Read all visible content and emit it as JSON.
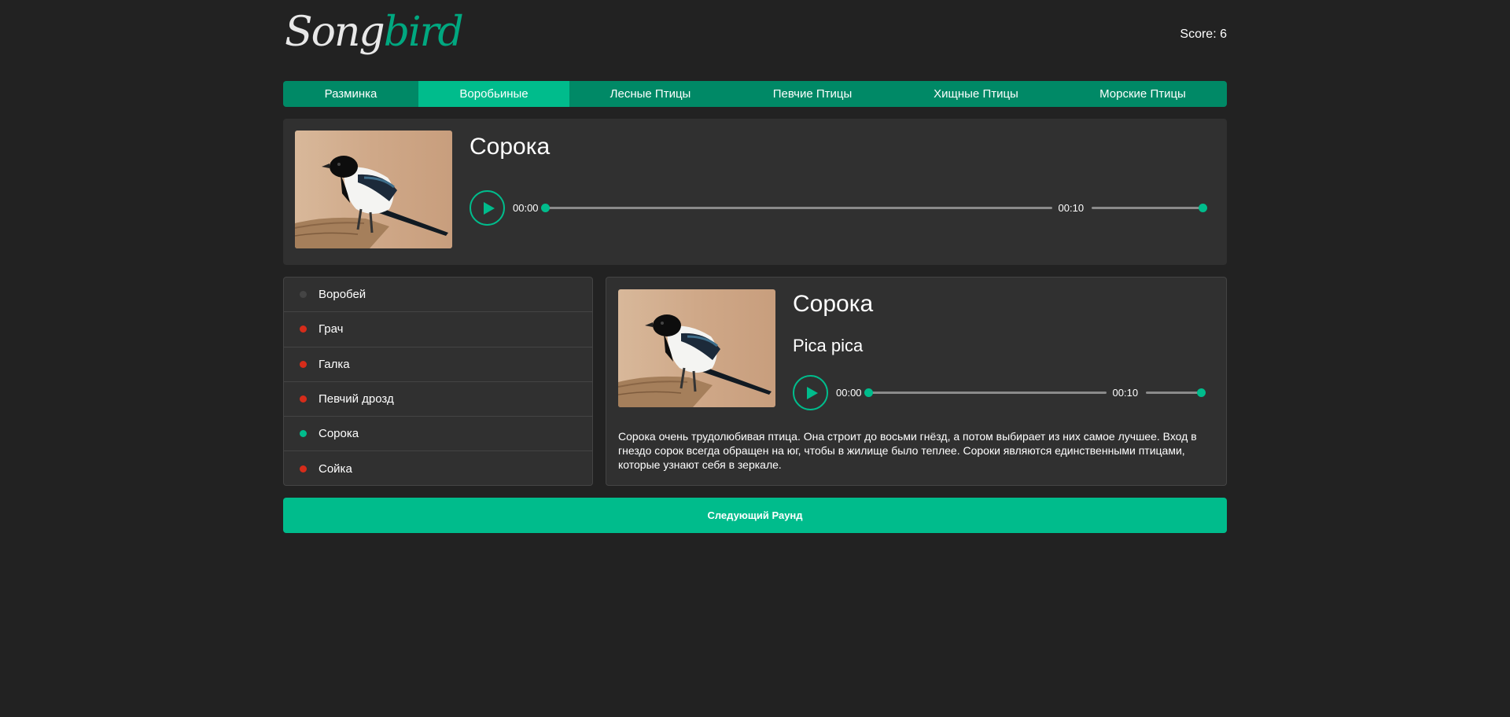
{
  "header": {
    "logo_part1": "Song",
    "logo_part2": "bird",
    "score": "Score: 6"
  },
  "nav": [
    {
      "label": "Разминка",
      "active": false
    },
    {
      "label": "Воробьиные",
      "active": true
    },
    {
      "label": "Лесные Птицы",
      "active": false
    },
    {
      "label": "Певчие Птицы",
      "active": false
    },
    {
      "label": "Хищные Птицы",
      "active": false
    },
    {
      "label": "Морские Птицы",
      "active": false
    }
  ],
  "question": {
    "title": "Сорока",
    "image_icon": "magpie-photo",
    "player": {
      "current": "00:00",
      "duration": "00:10",
      "progress": 0,
      "volume": 1
    }
  },
  "answers": [
    {
      "label": "Воробей",
      "status_color": "#444444"
    },
    {
      "label": "Грач",
      "status_color": "#d62c1a"
    },
    {
      "label": "Галка",
      "status_color": "#d62c1a"
    },
    {
      "label": "Певчий дрозд",
      "status_color": "#d62c1a"
    },
    {
      "label": "Сорока",
      "status_color": "#00bc8c"
    },
    {
      "label": "Сойка",
      "status_color": "#d62c1a"
    }
  ],
  "details": {
    "name": "Сорока",
    "latin": "Pica pica",
    "image_icon": "magpie-photo",
    "player": {
      "current": "00:00",
      "duration": "00:10",
      "progress": 0,
      "volume": 1
    },
    "description": "Сорока очень трудолюбивая птица. Она строит до восьми гнёзд, а потом выбирает из них самое лучшее. Вход в гнездо сорок всегда обращен на юг, чтобы в жилище было теплее. Сороки являются единственными птицами, которые узнают себя в зеркале."
  },
  "next_button": "Следующий Раунд",
  "colors": {
    "accent": "#00bc8c",
    "nav_bg": "#008966",
    "wrong": "#d62c1a",
    "unanswered": "#444444",
    "page_bg": "#222222",
    "panel_bg": "#303030"
  }
}
